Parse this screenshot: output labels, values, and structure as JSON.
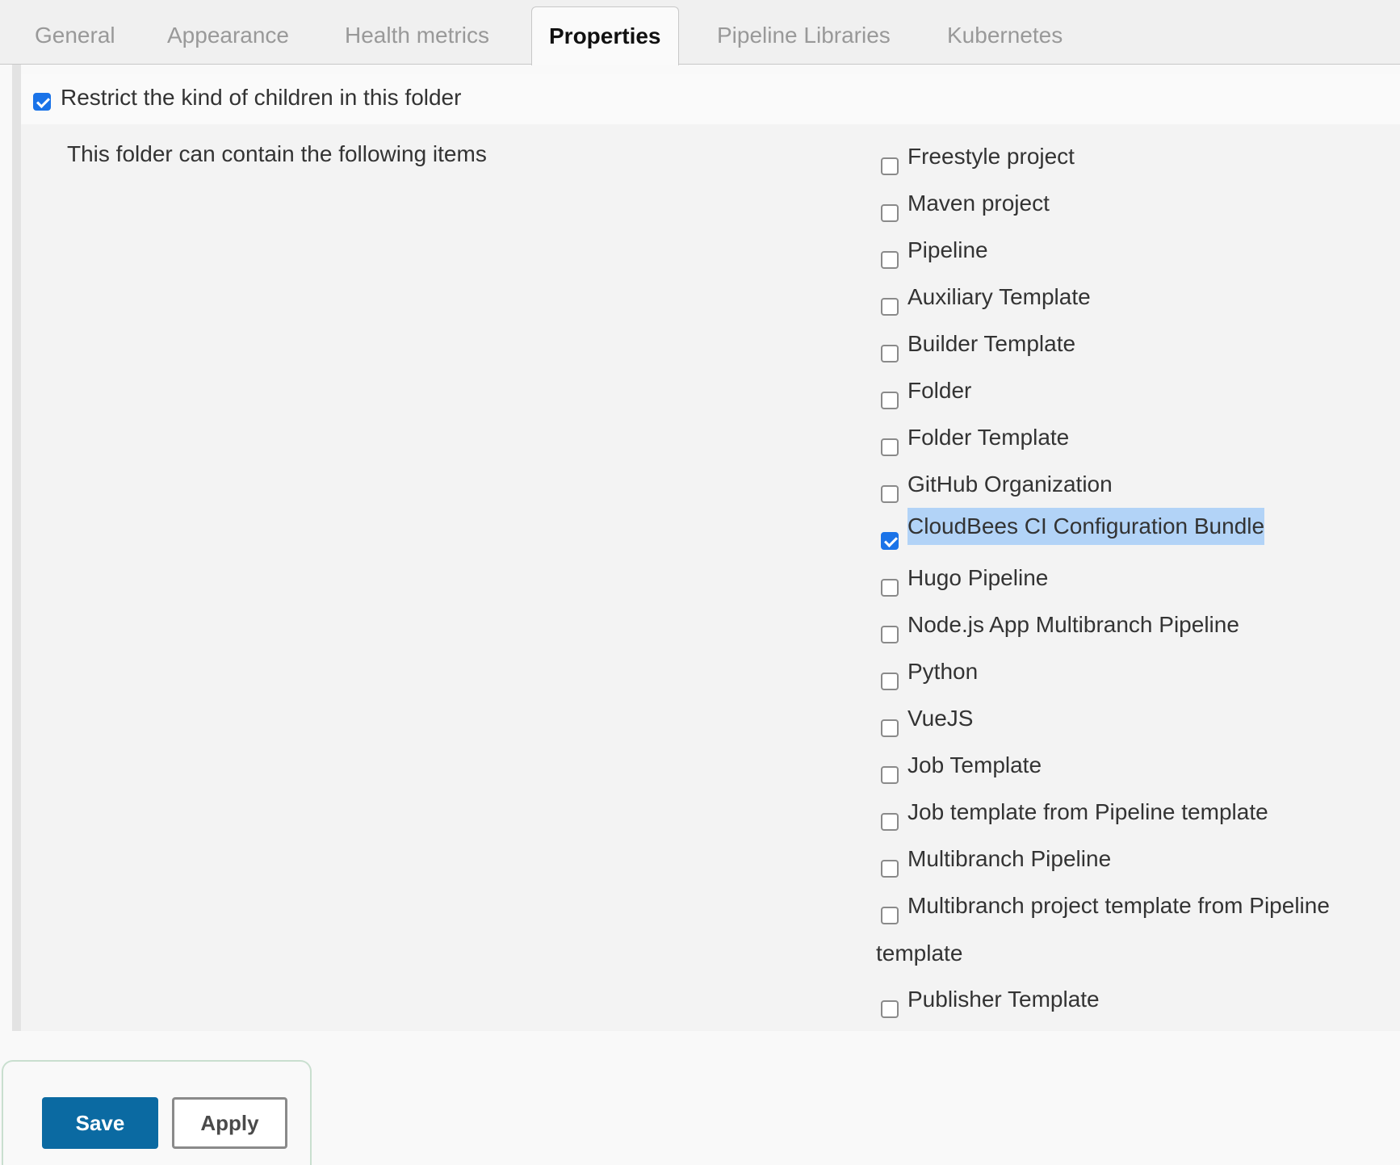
{
  "tabs": [
    {
      "label": "General",
      "active": false
    },
    {
      "label": "Appearance",
      "active": false
    },
    {
      "label": "Health metrics",
      "active": false
    },
    {
      "label": "Properties",
      "active": true
    },
    {
      "label": "Pipeline Libraries",
      "active": false
    },
    {
      "label": "Kubernetes",
      "active": false
    }
  ],
  "restrict": {
    "label": "Restrict the kind of children in this folder",
    "checked": true
  },
  "contain_label": "This folder can contain the following items",
  "items": [
    {
      "label": "Freestyle project",
      "checked": false
    },
    {
      "label": "Maven project",
      "checked": false
    },
    {
      "label": "Pipeline",
      "checked": false
    },
    {
      "label": "Auxiliary Template",
      "checked": false
    },
    {
      "label": "Builder Template",
      "checked": false
    },
    {
      "label": "Folder",
      "checked": false
    },
    {
      "label": "Folder Template",
      "checked": false
    },
    {
      "label": "GitHub Organization",
      "checked": false
    },
    {
      "label": "CloudBees CI Configuration Bundle",
      "checked": true,
      "highlighted": true
    },
    {
      "label": "Hugo Pipeline",
      "checked": false
    },
    {
      "label": "Node.js App Multibranch Pipeline",
      "checked": false
    },
    {
      "label": "Python",
      "checked": false
    },
    {
      "label": "VueJS",
      "checked": false
    },
    {
      "label": "Job Template",
      "checked": false
    },
    {
      "label": "Job template from Pipeline template",
      "checked": false
    },
    {
      "label": "Multibranch Pipeline",
      "checked": false
    },
    {
      "label": "Multibranch project template from Pipeline",
      "label_wrap": "template",
      "checked": false
    },
    {
      "label": "Publisher Template",
      "checked": false
    }
  ],
  "buttons": {
    "save": "Save",
    "apply": "Apply"
  },
  "colors": {
    "accent": "#1a73e8",
    "save_bg": "#0b6aa2",
    "selection": "#b2d3f7"
  }
}
